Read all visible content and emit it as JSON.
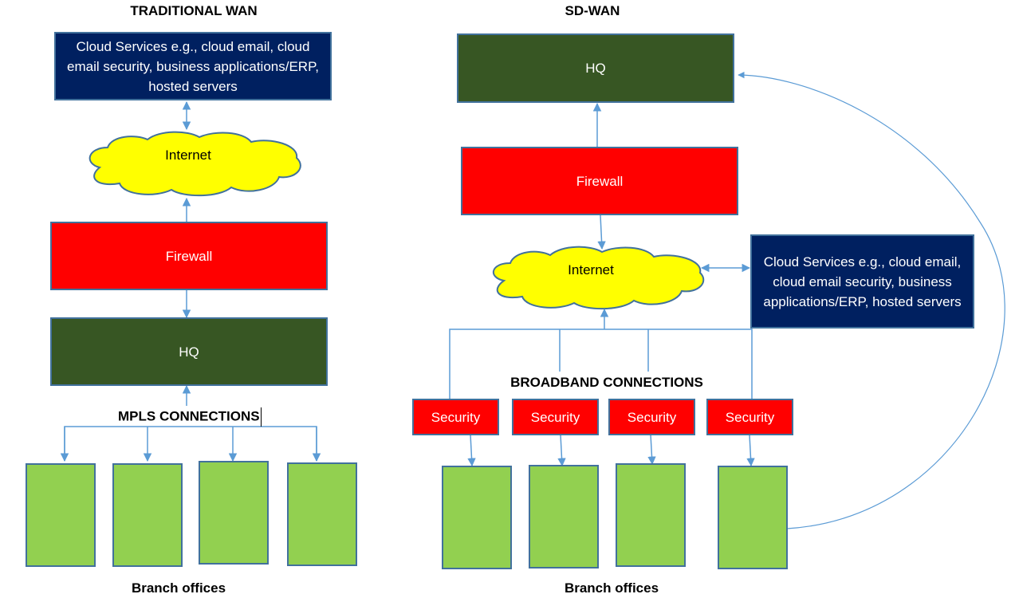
{
  "colors": {
    "cloud_services": "#002060",
    "hq": "#375623",
    "firewall": "#ff0000",
    "security": "#ff0000",
    "branch": "#92d050",
    "internet_cloud": "#ffff00",
    "border": "#41719c",
    "connector": "#5b9bd5"
  },
  "traditional": {
    "title": "TRADITIONAL WAN",
    "cloud_services": "Cloud Services e.g., cloud email, cloud email security, business applications/ERP, hosted servers",
    "internet": "Internet",
    "firewall": "Firewall",
    "hq": "HQ",
    "connections_label": "MPLS CONNECTIONS",
    "branch_count": 4,
    "branches_label": "Branch offices"
  },
  "sdwan": {
    "title": "SD-WAN",
    "hq": "HQ",
    "firewall": "Firewall",
    "internet": "Internet",
    "cloud_services": "Cloud Services e.g., cloud email, cloud email security, business applications/ERP, hosted servers",
    "connections_label": "BROADBAND CONNECTIONS",
    "security_boxes": [
      "Security",
      "Security",
      "Security",
      "Security"
    ],
    "branch_count": 4,
    "branches_label": "Branch offices"
  }
}
